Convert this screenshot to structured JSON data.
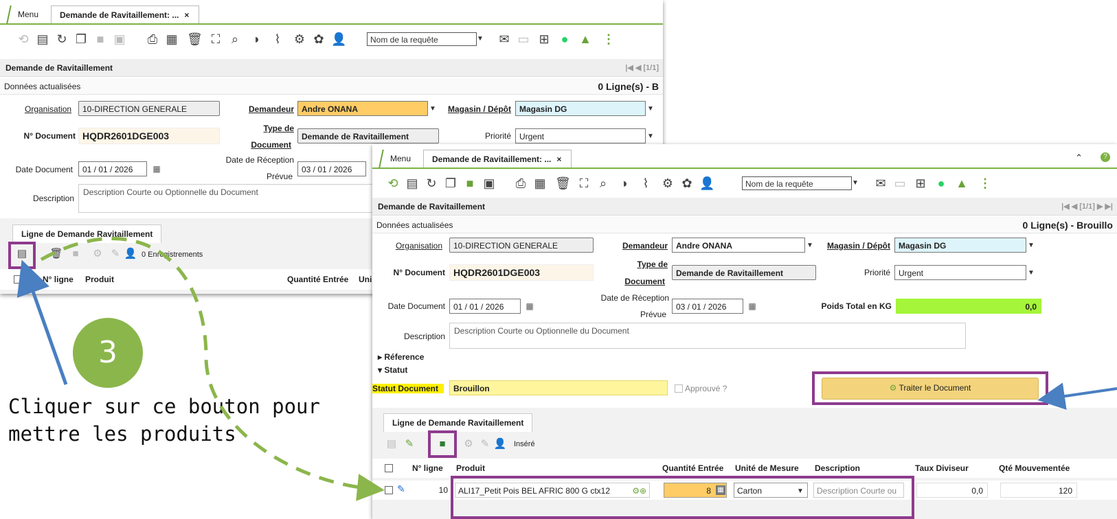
{
  "back_window": {
    "tabs": {
      "menu": "Menu",
      "active": "Demande de Ravitaillement: ...",
      "close": "×"
    },
    "query_placeholder": "Nom de la requête",
    "panel_title": "Demande de Ravitaillement",
    "nav": "[1/1]",
    "status_left": "Données actualisées",
    "status_right": "0 Ligne(s) - B",
    "labels": {
      "organisation": "Organisation",
      "demandeur": "Demandeur",
      "magasin": "Magasin / Dépôt",
      "n_document": "N° Document",
      "type_de": "Type de",
      "document": "Document",
      "priorite": "Priorité",
      "date_reception": "Date de Réception",
      "prevue": "Prévue",
      "date_document": "Date Document",
      "description": "Description"
    },
    "values": {
      "organisation": "10-DIRECTION GENERALE",
      "demandeur": "Andre ONANA",
      "magasin": "Magasin DG",
      "n_document": "HQDR2601DGE003",
      "type_document": "Demande de Ravitaillement",
      "priorite": "Urgent",
      "date_document": "01 / 01 / 2026",
      "date_reception": "03 / 01 / 2026",
      "description_placeholder": "Description Courte ou Optionnelle du Document"
    },
    "lines_tab": "Ligne de Demande Ravitaillement",
    "records": "0 Enregistrements",
    "columns": [
      "N° ligne",
      "Produit",
      "Quantité Entrée",
      "Uni"
    ]
  },
  "front_window": {
    "tabs": {
      "menu": "Menu",
      "active": "Demande de Ravitaillement: ...",
      "close": "×"
    },
    "query_placeholder": "Nom de la requête",
    "panel_title": "Demande de Ravitaillement",
    "nav": "[1/1]",
    "status_left": "Données actualisées",
    "status_right": "0 Ligne(s) - Brouillo",
    "labels": {
      "organisation": "Organisation",
      "demandeur": "Demandeur",
      "magasin": "Magasin / Dépôt",
      "n_document": "N° Document",
      "type_de": "Type de",
      "document": "Document",
      "priorite": "Priorité",
      "date_reception": "Date de Réception",
      "prevue": "Prévue",
      "date_document": "Date Document",
      "poids_total": "Poids Total en KG",
      "description": "Description",
      "reference": "Réference",
      "statut": "Statut",
      "statut_document": "Statut Document",
      "approuve": "Approuvé ?"
    },
    "values": {
      "organisation": "10-DIRECTION GENERALE",
      "demandeur": "Andre ONANA",
      "magasin": "Magasin DG",
      "n_document": "HQDR2601DGE003",
      "type_document": "Demande de Ravitaillement",
      "priorite": "Urgent",
      "date_document": "01 / 01 / 2026",
      "date_reception": "03 / 01 / 2026",
      "poids_total": "0,0",
      "description_placeholder": "Description Courte ou Optionnelle du Document",
      "statut_document": "Brouillon"
    },
    "process_button": "Traiter le Document",
    "lines_tab": "Ligne de Demande Ravitaillement",
    "inserted": "Inséré",
    "columns": [
      "N° ligne",
      "Produit",
      "Quantité Entrée",
      "Unité de Mesure",
      "Description",
      "Taux Diviseur",
      "Qté Mouvementée"
    ],
    "row": {
      "line_no": "10",
      "product": "ALI17_Petit Pois BEL AFRIC 800 G ctx12",
      "quantity": "8",
      "unit": "Carton",
      "description_placeholder": "Description Courte ou",
      "taux_diviseur": "0,0",
      "qte_mouvementee": "120"
    }
  },
  "annotation": {
    "step_number": "3",
    "instruction": "Cliquer sur ce bouton pour mettre les produits"
  },
  "colors": {
    "accent_green": "#7cb342",
    "highlight_purple": "#8e3b8e",
    "badge_green": "#8bb64c",
    "arrow_blue": "#4a7fc1",
    "dashed_arrow": "#8bb64c"
  }
}
